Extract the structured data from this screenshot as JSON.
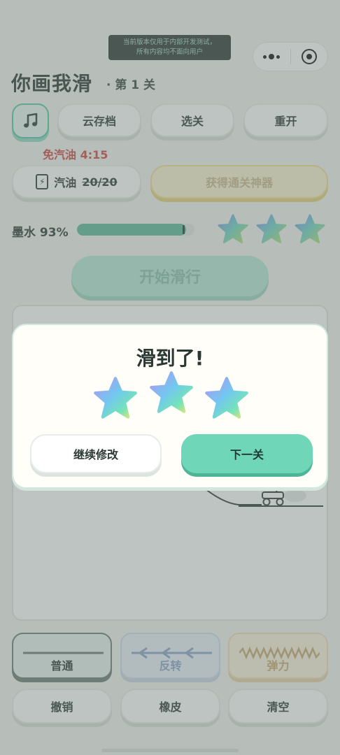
{
  "dev_banner": {
    "line1": "当前版本仅用于内部开发测试，",
    "line2": "所有内容均不面向用户"
  },
  "header": {
    "title": "你画我滑",
    "level": "· 第 1 关"
  },
  "toolbar": {
    "music_icon": "music-note-icon",
    "cloud_save": "云存档",
    "select_level": "选关",
    "restart": "重开"
  },
  "free_gas": "免汽油 4:15",
  "gas": {
    "label": "汽油",
    "value": "20/20",
    "icon": "fuel-bolt-icon"
  },
  "win_item": "获得通关神器",
  "ink": {
    "label": "墨水 93%",
    "percent": 93
  },
  "top_stars": 3,
  "start_button": "开始滑行",
  "tools": {
    "normal": "普通",
    "reverse": "反转",
    "spring": "弹力"
  },
  "actions": {
    "undo": "撤销",
    "eraser": "橡皮",
    "clear": "清空"
  },
  "dialog": {
    "title": "滑到了!",
    "stars": 3,
    "continue_edit": "继续修改",
    "next_level": "下一关"
  },
  "colors": {
    "accent": "#6fd6b8",
    "ink": "#5bb89a",
    "warning": "#d0463f"
  }
}
